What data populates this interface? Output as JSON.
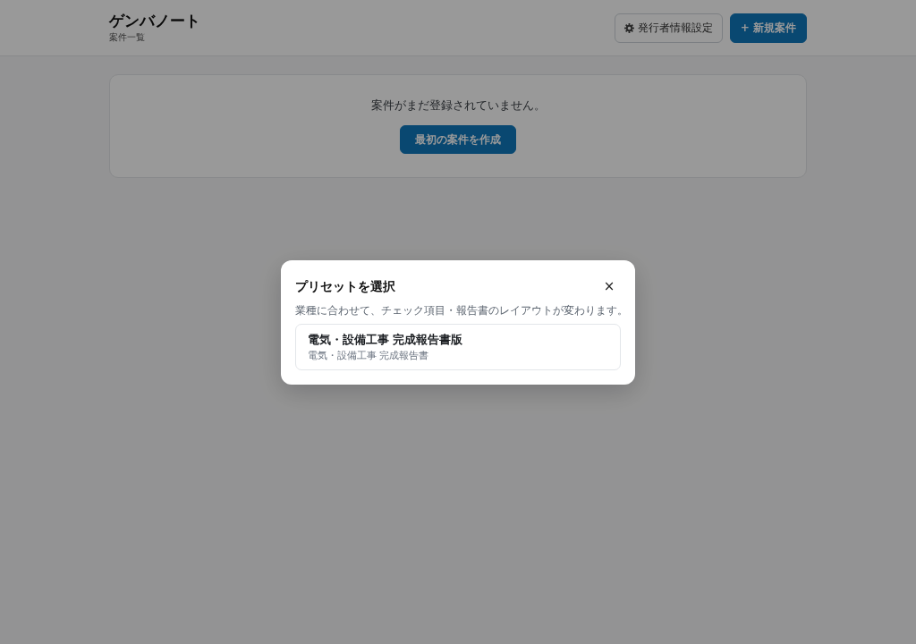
{
  "header": {
    "title": "ゲンバノート",
    "subtitle": "案件一覧",
    "buttons": [
      {
        "kind": "settings",
        "label": "発行者情報設定"
      },
      {
        "kind": "primary",
        "label": "+ 新規案件"
      }
    ]
  },
  "empty_state": {
    "message": "案件がまだ登録されていません。",
    "button": "最初の案件を作成"
  },
  "modal": {
    "title": "プリセットを選択",
    "close": "×",
    "description": "業種に合わせて、チェック項目・報告書のレイアウトが変わります。",
    "presets": [
      {
        "title": "電気・設備工事 完成報告書版",
        "subtitle": "電気・設備工事 完成報告書"
      }
    ]
  }
}
